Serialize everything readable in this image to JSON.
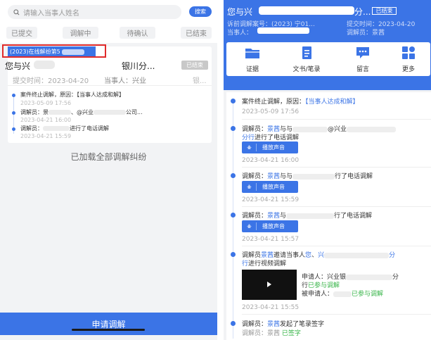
{
  "left": {
    "search": {
      "placeholder": "请输入当事人姓名",
      "button": "搜索"
    },
    "tabs": [
      "已提交",
      "调解中",
      "待确认",
      "已结束"
    ],
    "case": {
      "header": "(2023)在线解纷第5",
      "party_left": "您与兴",
      "party_right": "银川分...",
      "status": "已结束",
      "submit_time": "提交时间：2023-04-20",
      "parties": "当事人：兴业",
      "parties_tail": "银...",
      "timeline": [
        {
          "text": "案件终止调解，原因：【当事人达成和解】",
          "date": "2023-05-09 17:56"
        },
        {
          "text": "调解员：景",
          "text2": "、@兴业",
          "text3": "公司...",
          "date": "2023-04-21 16:00"
        },
        {
          "text": "调解员：",
          "text2": "进行了电话调解",
          "date": "2023-04-21 15:59"
        }
      ]
    },
    "loaded_all": "已加载全部调解纠纷",
    "apply_button": "申请调解"
  },
  "right": {
    "title": "您与兴",
    "title_tail": "分...",
    "status": "已结束",
    "meta_case_no": "诉前调解案号：(2023) 宁01...",
    "meta_submit": "提交时间：2023-04-20",
    "meta_party": "当事人：",
    "meta_mediator": "调解员：景茜",
    "functions": [
      {
        "icon": "folder-icon",
        "label": "证据"
      },
      {
        "icon": "document-icon",
        "label": "文书/笔录"
      },
      {
        "icon": "chat-icon",
        "label": "留言"
      },
      {
        "icon": "grid-icon",
        "label": "更多"
      }
    ],
    "feed": {
      "item1": {
        "prefix": "案件终止调解，原因：",
        "reason": "【当事人达成和解】",
        "date": "2023-05-09 17:56"
      },
      "item2": {
        "prefix": "调解员：",
        "name": "景茜",
        "mid": "与与",
        "at": "@兴业",
        "line2_blue": "分行",
        "line2": "进行了电话调解",
        "audio": "播放声音",
        "date": "2023-04-21 16:00"
      },
      "item3": {
        "prefix": "调解员：",
        "name": "景茜",
        "mid": "与与",
        "tail": "行了电话调解",
        "audio": "播放声音",
        "date": "2023-04-21 15:59"
      },
      "item4": {
        "prefix": "调解员：",
        "name": "景茜",
        "mid": "与",
        "tail": "行了电话调解",
        "audio": "播放声音",
        "date": "2023-04-21 15:57"
      },
      "item5": {
        "prefix": "调解员",
        "name": "景茜",
        "mid": "邀请当事人",
        "party": "您",
        "sep": "、",
        "party2": "兴",
        "line1_tail": "分",
        "line2_blue": "行",
        "line2": "进行视频调解",
        "applicant": "申请人：兴业银",
        "applicant_tail": "分",
        "applicant_status_prefix": "行",
        "applicant_status": "已参与调解",
        "respondent": "被申请人：",
        "respondent_status": "已参与调解",
        "date": "2023-04-21 15:55"
      },
      "item6": {
        "prefix": "调解员：",
        "name": "景茜",
        "text": "发起了笔录签字",
        "sub": "调解员：景茜",
        "sub_status": "已签字"
      }
    }
  },
  "colors": {
    "primary": "#3b74e6",
    "success": "#39b54a",
    "highlight_box": "#e02b2b"
  }
}
